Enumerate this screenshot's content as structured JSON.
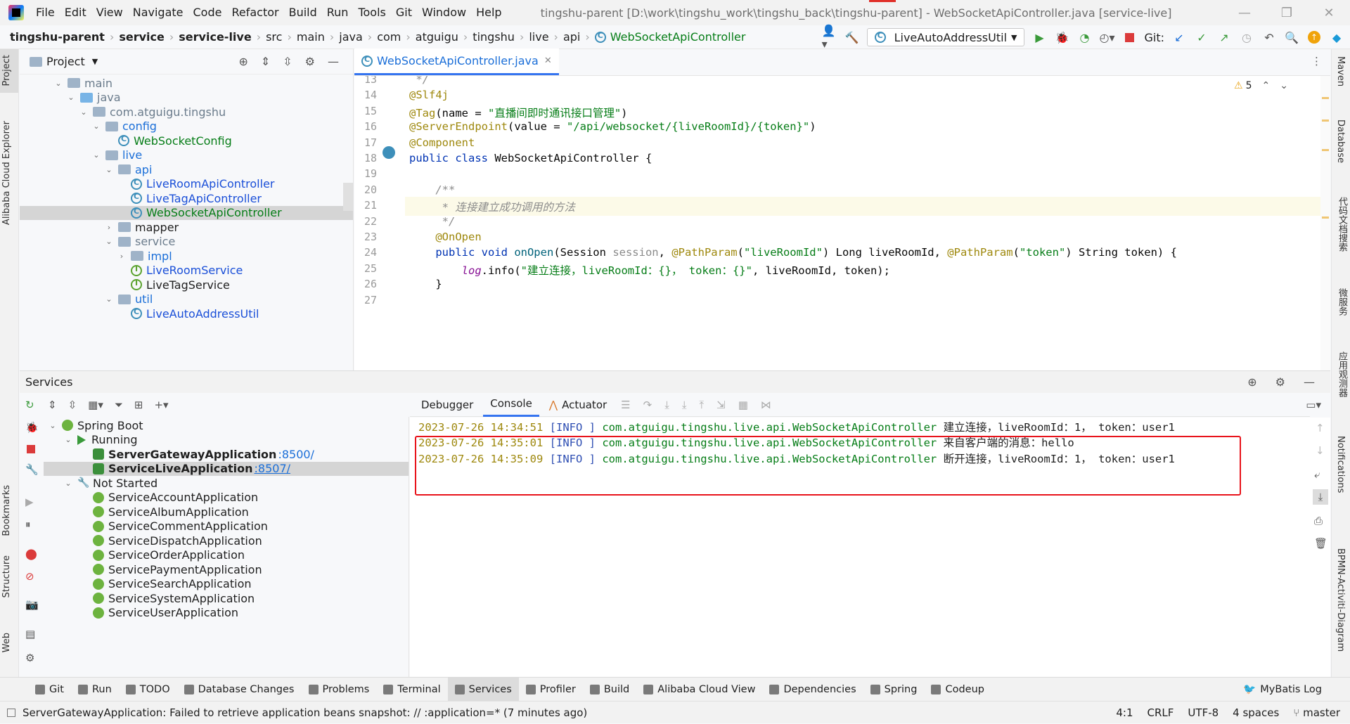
{
  "window": {
    "menu": [
      "File",
      "Edit",
      "View",
      "Navigate",
      "Code",
      "Refactor",
      "Build",
      "Run",
      "Tools",
      "Git",
      "Window",
      "Help"
    ],
    "title": "tingshu-parent [D:\\work\\tingshu_work\\tingshu_back\\tingshu-parent] - WebSocketApiController.java [service-live]",
    "controls": [
      "—",
      "❐",
      "✕"
    ]
  },
  "breadcrumb": [
    "tingshu-parent",
    "service",
    "service-live",
    "src",
    "main",
    "java",
    "com",
    "atguigu",
    "tingshu",
    "live",
    "api",
    "WebSocketApiController"
  ],
  "toolbar": {
    "run_config": "LiveAutoAddressUtil",
    "git_label": "Git:"
  },
  "left_strip": [
    "Project",
    "Alibaba Cloud Explorer",
    "Bookmarks",
    "Structure",
    "Web"
  ],
  "right_strip": [
    "Maven",
    "Database",
    "代码文档搜索",
    "微服务",
    "应用观测器",
    "Notifications",
    "BPMN-Activiti-Diagram"
  ],
  "project": {
    "header": "Project",
    "tree": [
      {
        "label": "main",
        "indent": 2,
        "arrow": "down",
        "icon": "folder",
        "color": "#6b7c8c"
      },
      {
        "label": "java",
        "indent": 3,
        "arrow": "down",
        "icon": "folder-blue",
        "color": "#6b7c8c"
      },
      {
        "label": "com.atguigu.tingshu",
        "indent": 4,
        "arrow": "down",
        "icon": "folder",
        "color": "#6b7c8c"
      },
      {
        "label": "config",
        "indent": 5,
        "arrow": "down",
        "icon": "folder",
        "color": "#1a6ed8"
      },
      {
        "label": "WebSocketConfig",
        "indent": 6,
        "arrow": "",
        "icon": "class",
        "color": "#067d17"
      },
      {
        "label": "live",
        "indent": 5,
        "arrow": "down",
        "icon": "folder",
        "color": "#1a6ed8"
      },
      {
        "label": "api",
        "indent": 6,
        "arrow": "down",
        "icon": "folder",
        "color": "#1a6ed8"
      },
      {
        "label": "LiveRoomApiController",
        "indent": 7,
        "arrow": "",
        "icon": "class",
        "color": "#1a4fd8"
      },
      {
        "label": "LiveTagApiController",
        "indent": 7,
        "arrow": "",
        "icon": "class",
        "color": "#1a4fd8"
      },
      {
        "label": "WebSocketApiController",
        "indent": 7,
        "arrow": "",
        "icon": "class",
        "color": "#067d17",
        "selected": true
      },
      {
        "label": "mapper",
        "indent": 6,
        "arrow": "right",
        "icon": "folder",
        "color": "#1f1f1f"
      },
      {
        "label": "service",
        "indent": 6,
        "arrow": "down",
        "icon": "folder",
        "color": "#6b7c8c"
      },
      {
        "label": "impl",
        "indent": 7,
        "arrow": "right",
        "icon": "folder",
        "color": "#1a6ed8"
      },
      {
        "label": "LiveRoomService",
        "indent": 7,
        "arrow": "",
        "icon": "interface",
        "color": "#1a4fd8"
      },
      {
        "label": "LiveTagService",
        "indent": 7,
        "arrow": "",
        "icon": "interface",
        "color": "#1f1f1f"
      },
      {
        "label": "util",
        "indent": 6,
        "arrow": "down",
        "icon": "folder",
        "color": "#1a6ed8"
      },
      {
        "label": "LiveAutoAddressUtil",
        "indent": 7,
        "arrow": "",
        "icon": "class",
        "color": "#1a4fd8"
      }
    ]
  },
  "editor": {
    "tab": "WebSocketApiController.java",
    "warnings": "5",
    "lines": [
      {
        "n": "13",
        "html": " */",
        "cls": "cmt"
      },
      {
        "n": "14",
        "parts": [
          [
            "@Slf4j",
            "ann"
          ]
        ]
      },
      {
        "n": "15",
        "parts": [
          [
            "@Tag",
            "ann"
          ],
          [
            "(name = ",
            ""
          ],
          [
            "\"直播间即时通讯接口管理\"",
            "str"
          ],
          [
            ")",
            ""
          ]
        ]
      },
      {
        "n": "16",
        "parts": [
          [
            "@ServerEndpoint",
            "ann"
          ],
          [
            "(value = ",
            ""
          ],
          [
            "\"/api/websocket/{liveRoomId}/{token}\"",
            "str"
          ],
          [
            ")",
            ""
          ]
        ]
      },
      {
        "n": "17",
        "parts": [
          [
            "@Component",
            "ann"
          ]
        ]
      },
      {
        "n": "18",
        "parts": [
          [
            "public class ",
            "kw"
          ],
          [
            "WebSocketApiController {",
            ""
          ]
        ]
      },
      {
        "n": "19",
        "parts": []
      },
      {
        "n": "20",
        "parts": [
          [
            "    /**",
            "cmt"
          ]
        ]
      },
      {
        "n": "21",
        "parts": [
          [
            "     * 连接建立成功调用的方法",
            "cmt"
          ]
        ]
      },
      {
        "n": "22",
        "parts": [
          [
            "     */",
            "cmt"
          ]
        ]
      },
      {
        "n": "23",
        "parts": [
          [
            "    ",
            ""
          ],
          [
            "@OnOpen",
            "ann"
          ]
        ]
      },
      {
        "n": "24",
        "parts": [
          [
            "    ",
            ""
          ],
          [
            "public void ",
            "kw"
          ],
          [
            "onOpen",
            "mth"
          ],
          [
            "(Session ",
            ""
          ],
          [
            "session",
            "param"
          ],
          [
            ", ",
            ""
          ],
          [
            "@PathParam",
            "ann"
          ],
          [
            "(",
            ""
          ],
          [
            "\"liveRoomId\"",
            "str"
          ],
          [
            ") Long liveRoomId, ",
            ""
          ],
          [
            "@PathParam",
            "ann"
          ],
          [
            "(",
            ""
          ],
          [
            "\"token\"",
            "str"
          ],
          [
            ") String token) {",
            ""
          ]
        ]
      },
      {
        "n": "25",
        "parts": [
          [
            "        ",
            ""
          ],
          [
            "log",
            "fld"
          ],
          [
            ".info(",
            ""
          ],
          [
            "\"建立连接，liveRoomId：{}， token：{}\"",
            "str"
          ],
          [
            ", liveRoomId, token);",
            ""
          ]
        ]
      },
      {
        "n": "26",
        "parts": [
          [
            "    }",
            ""
          ]
        ]
      },
      {
        "n": "27",
        "parts": []
      }
    ]
  },
  "services": {
    "header": "Services",
    "tree": [
      {
        "label": "Spring Boot",
        "indent": 0,
        "arrow": "down",
        "icon": "springboot",
        "bold": false
      },
      {
        "label": "Running",
        "indent": 1,
        "arrow": "down",
        "icon": "play",
        "bold": false
      },
      {
        "label": "ServerGatewayApplication",
        "port": ":8500/",
        "indent": 2,
        "arrow": "",
        "icon": "bug",
        "bold": true
      },
      {
        "label": "ServiceLiveApplication",
        "port": ":8507/",
        "indent": 2,
        "arrow": "",
        "icon": "bug",
        "bold": true,
        "selected": true
      },
      {
        "label": "Not Started",
        "indent": 1,
        "arrow": "down",
        "icon": "wrench",
        "bold": false
      },
      {
        "label": "ServiceAccountApplication",
        "indent": 2,
        "arrow": "",
        "icon": "springboot",
        "bold": false
      },
      {
        "label": "ServiceAlbumApplication",
        "indent": 2,
        "arrow": "",
        "icon": "springboot",
        "bold": false
      },
      {
        "label": "ServiceCommentApplication",
        "indent": 2,
        "arrow": "",
        "icon": "springboot",
        "bold": false
      },
      {
        "label": "ServiceDispatchApplication",
        "indent": 2,
        "arrow": "",
        "icon": "springboot",
        "bold": false
      },
      {
        "label": "ServiceOrderApplication",
        "indent": 2,
        "arrow": "",
        "icon": "springboot",
        "bold": false
      },
      {
        "label": "ServicePaymentApplication",
        "indent": 2,
        "arrow": "",
        "icon": "springboot",
        "bold": false
      },
      {
        "label": "ServiceSearchApplication",
        "indent": 2,
        "arrow": "",
        "icon": "springboot",
        "bold": false
      },
      {
        "label": "ServiceSystemApplication",
        "indent": 2,
        "arrow": "",
        "icon": "springboot",
        "bold": false
      },
      {
        "label": "ServiceUserApplication",
        "indent": 2,
        "arrow": "",
        "icon": "springboot",
        "bold": false
      }
    ],
    "console_tabs": [
      "Debugger",
      "Console",
      "Actuator"
    ],
    "logs": [
      {
        "ts": "2023-07-26 14:34:51",
        "lvl": "[INFO ]",
        "cls": "com.atguigu.tingshu.live.api.WebSocketApiController",
        "msg": "建立连接，liveRoomId：1， token：user1"
      },
      {
        "ts": "2023-07-26 14:35:01",
        "lvl": "[INFO ]",
        "cls": "com.atguigu.tingshu.live.api.WebSocketApiController",
        "msg": "来自客户端的消息：hello"
      },
      {
        "ts": "2023-07-26 14:35:09",
        "lvl": "[INFO ]",
        "cls": "com.atguigu.tingshu.live.api.WebSocketApiController",
        "msg": "断开连接，liveRoomId：1， token：user1"
      }
    ]
  },
  "bottom_tools": [
    {
      "label": "Git",
      "icon": "git-icon"
    },
    {
      "label": "Run",
      "icon": "run-icon"
    },
    {
      "label": "TODO",
      "icon": "todo-icon"
    },
    {
      "label": "Database Changes",
      "icon": "database-icon"
    },
    {
      "label": "Problems",
      "icon": "problems-icon"
    },
    {
      "label": "Terminal",
      "icon": "terminal-icon"
    },
    {
      "label": "Services",
      "icon": "services-icon",
      "active": true
    },
    {
      "label": "Profiler",
      "icon": "profiler-icon"
    },
    {
      "label": "Build",
      "icon": "build-icon"
    },
    {
      "label": "Alibaba Cloud View",
      "icon": "cloud-icon"
    },
    {
      "label": "Dependencies",
      "icon": "dependencies-icon"
    },
    {
      "label": "Spring",
      "icon": "spring-icon"
    },
    {
      "label": "Codeup",
      "icon": "codeup-icon"
    }
  ],
  "mybatis_log": "MyBatis Log",
  "status": {
    "message": "ServerGatewayApplication: Failed to retrieve application beans snapshot: // :application=* (7 minutes ago)",
    "position": "4:1",
    "line_sep": "CRLF",
    "encoding": "UTF-8",
    "indent": "4 spaces",
    "branch": "master"
  }
}
